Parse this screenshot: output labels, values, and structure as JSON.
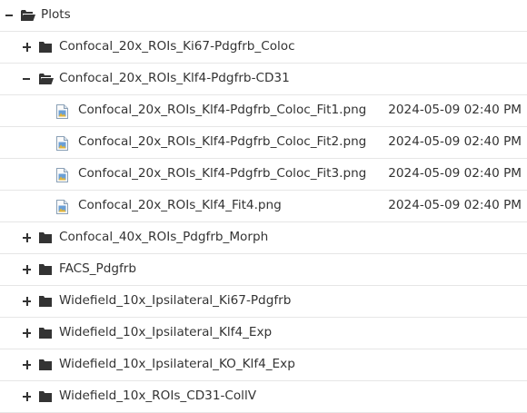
{
  "root": {
    "name": "Plots",
    "expanded": true,
    "icon": "folder-open-icon"
  },
  "folders_before": [
    {
      "name": "Confocal_20x_ROIs_Ki67-Pdgfrb_Coloc",
      "expanded": false
    }
  ],
  "open_folder": {
    "name": "Confocal_20x_ROIs_Klf4-Pdgfrb-CD31",
    "expanded": true
  },
  "files": [
    {
      "name": "Confocal_20x_ROIs_Klf4-Pdgfrb_Coloc_Fit1.png",
      "modified": "2024-05-09 02:40 PM"
    },
    {
      "name": "Confocal_20x_ROIs_Klf4-Pdgfrb_Coloc_Fit2.png",
      "modified": "2024-05-09 02:40 PM"
    },
    {
      "name": "Confocal_20x_ROIs_Klf4-Pdgfrb_Coloc_Fit3.png",
      "modified": "2024-05-09 02:40 PM"
    },
    {
      "name": "Confocal_20x_ROIs_Klf4_Fit4.png",
      "modified": "2024-05-09 02:40 PM"
    }
  ],
  "folders_after": [
    {
      "name": "Confocal_40x_ROIs_Pdgfrb_Morph",
      "expanded": false
    },
    {
      "name": "FACS_Pdgfrb",
      "expanded": false
    },
    {
      "name": "Widefield_10x_Ipsilateral_Ki67-Pdgfrb",
      "expanded": false
    },
    {
      "name": "Widefield_10x_Ipsilateral_Klf4_Exp",
      "expanded": false
    },
    {
      "name": "Widefield_10x_Ipsilateral_KO_Klf4_Exp",
      "expanded": false
    },
    {
      "name": "Widefield_10x_ROIs_CD31-CollV",
      "expanded": false
    }
  ]
}
